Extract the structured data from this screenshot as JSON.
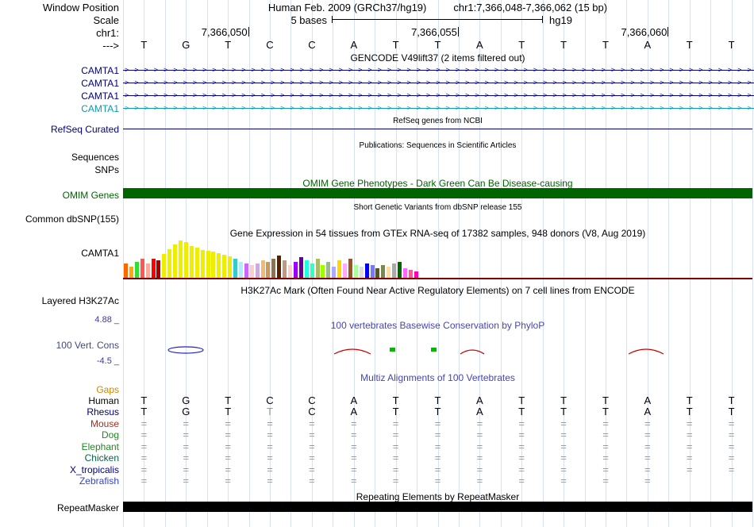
{
  "window": {
    "label": "Window Position",
    "assembly_title": "Human Feb. 2009 (GRCh37/hg19)",
    "position": "chr1:7,366,048-7,366,062 (15 bp)"
  },
  "scale": {
    "label": "Scale",
    "value": "5 bases",
    "assembly": "hg19"
  },
  "ruler": {
    "chrom_label": "chr1:",
    "strand_label": "--->",
    "coordinates": [
      {
        "text": "7,366,050",
        "boundary": 3
      },
      {
        "text": "7,366,055",
        "boundary": 8
      },
      {
        "text": "7,366,060",
        "boundary": 13
      }
    ]
  },
  "sequence": [
    "T",
    "G",
    "T",
    "C",
    "C",
    "A",
    "T",
    "T",
    "A",
    "T",
    "T",
    "T",
    "A",
    "T",
    "T"
  ],
  "colors": {
    "grid": "#d7e1f2",
    "gene_navy": "#000080",
    "gene_teal": "#0d98b4",
    "omim_green": "#006400",
    "gtex_baseline": "#7d0000",
    "conservation_blue": "#4646b0",
    "gaps_orange": "#cc8800",
    "repeat_black": "#000000"
  },
  "gencode": {
    "title": "GENCODE V49lift37 (2 items filtered out)",
    "items": [
      {
        "label": "CAMTA1",
        "color": "#000080"
      },
      {
        "label": "CAMTA1",
        "color": "#000080"
      },
      {
        "label": "CAMTA1",
        "color": "#000080"
      },
      {
        "label": "CAMTA1",
        "color": "#0d98b4"
      }
    ]
  },
  "refseq": {
    "subtitle": "RefSeq genes from NCBI",
    "label": "RefSeq Curated"
  },
  "publications": {
    "subtitle": "Publications: Sequences in Scientific Articles",
    "sequences_label": "Sequences",
    "snps_label": "SNPs"
  },
  "omim": {
    "title": "OMIM Gene Phenotypes - Dark Green Can Be Disease-causing",
    "label": "OMIM Genes"
  },
  "dbsnp": {
    "subtitle": "Short Genetic Variants from dbSNP release 155",
    "label": "Common dbSNP(155)"
  },
  "gtex": {
    "title": "Gene Expression in 54 tissues from GTEx RNA-seq of 17382 samples, 948 donors (V8, Aug 2019)",
    "label": "CAMTA1",
    "colors": [
      "#FF6600",
      "#FFAA00",
      "#33DD33",
      "#FF5555",
      "#FFAA99",
      "#FF0000",
      "#AA0000",
      "#EEEE00",
      "#EEEE00",
      "#EEEE00",
      "#EEEE00",
      "#EEEE00",
      "#EEEE00",
      "#EEEE00",
      "#EEEE00",
      "#EEEE00",
      "#EEEE00",
      "#EEEE00",
      "#EEEE00",
      "#EEEE00",
      "#33CCCC",
      "#AAEEFF",
      "#CC66FF",
      "#FFCCCC",
      "#CCAADD",
      "#EEBB77",
      "#CC9955",
      "#8B7355",
      "#552200",
      "#BB9988",
      "#FFCCCC",
      "#9900FF",
      "#660099",
      "#22FFDD",
      "#33FFC2",
      "#AABB66",
      "#99FF00",
      "#99BB88",
      "#AAAAFF",
      "#FFD700",
      "#FFAAFF",
      "#995522",
      "#AAFF99",
      "#DDDDDD",
      "#0000FF",
      "#7777FF",
      "#555522",
      "#778855",
      "#FFDD99",
      "#AAAAAA",
      "#006600",
      "#FF66FF",
      "#FF5599",
      "#FF00BB"
    ],
    "heights": [
      18,
      14,
      20,
      24,
      18,
      24,
      22,
      30,
      36,
      42,
      47,
      45,
      40,
      38,
      35,
      34,
      33,
      31,
      29,
      27,
      24,
      20,
      18,
      16,
      18,
      22,
      20,
      24,
      28,
      22,
      16,
      20,
      26,
      22,
      18,
      24,
      16,
      20,
      14,
      22,
      18,
      24,
      16,
      14,
      18,
      16,
      12,
      16,
      14,
      18,
      20,
      12,
      10,
      8
    ]
  },
  "h3k27ac": {
    "title": "H3K27Ac Mark (Often Found Near Active Regulatory Elements) on 7 cell lines from ENCODE",
    "label": "Layered H3K27Ac"
  },
  "phylop": {
    "title": "100 vertebrates Basewise Conservation by PhyloP",
    "label": "100 Vert. Cons",
    "max_label": "4.88 _",
    "min_label": "-4.5 _"
  },
  "multiz": {
    "title": "Multiz Alignments of 100 Vertebrates",
    "gaps_label": "Gaps",
    "rows": [
      {
        "label": "Human",
        "color": "#000000",
        "cell_color": "#000000",
        "cells": [
          "T",
          "G",
          "T",
          "C",
          "C",
          "A",
          "T",
          "T",
          "A",
          "T",
          "T",
          "T",
          "A",
          "T",
          "T"
        ]
      },
      {
        "label": "Rhesus",
        "color": "#000066",
        "cell_color": "#000000",
        "gray_cells": [
          3
        ],
        "cells": [
          "T",
          "G",
          "T",
          "T",
          "C",
          "A",
          "T",
          "T",
          "A",
          "T",
          "T",
          "T",
          "A",
          "T",
          "T"
        ]
      },
      {
        "label": "Mouse",
        "color": "#993322",
        "cell_color": "#999999",
        "cells": [
          "=",
          "=",
          "=",
          "=",
          "=",
          "=",
          "=",
          "=",
          "=",
          "=",
          "=",
          "=",
          "=",
          "=",
          "="
        ]
      },
      {
        "label": "Dog",
        "color": "#228822",
        "cell_color": "#999999",
        "cells": [
          "=",
          "=",
          "=",
          "=",
          "=",
          "=",
          "=",
          "=",
          "=",
          "=",
          "=",
          "=",
          "=",
          "=",
          "="
        ]
      },
      {
        "label": "Elephant",
        "color": "#228822",
        "cell_color": "#999999",
        "cells": [
          "=",
          "=",
          "=",
          "=",
          "=",
          "=",
          "=",
          "=",
          "=",
          "=",
          "=",
          "=",
          "=",
          "=",
          "="
        ]
      },
      {
        "label": "Chicken",
        "color": "#006644",
        "cell_color": "#999999",
        "cells": [
          "=",
          "=",
          "=",
          "=",
          "=",
          "=",
          "=",
          "=",
          "=",
          "=",
          "=",
          "=",
          "=",
          "=",
          "="
        ]
      },
      {
        "label": "X_tropicalis",
        "color": "#000088",
        "cell_color": "#999999",
        "cells": [
          "=",
          "=",
          "=",
          "=",
          "=",
          "=",
          "=",
          "=",
          "=",
          "=",
          "=",
          "=",
          "=",
          "=",
          "="
        ]
      },
      {
        "label": "Zebrafish",
        "color": "#3344cc",
        "cell_color": "#999999",
        "cells": [
          "=",
          "=",
          "=",
          "=",
          "=",
          "=",
          "=",
          "=",
          "=",
          "=",
          "=",
          "=",
          "=",
          null,
          null
        ]
      }
    ]
  },
  "repeatmasker": {
    "title": "Repeating Elements by RepeatMasker",
    "label": "RepeatMasker"
  }
}
